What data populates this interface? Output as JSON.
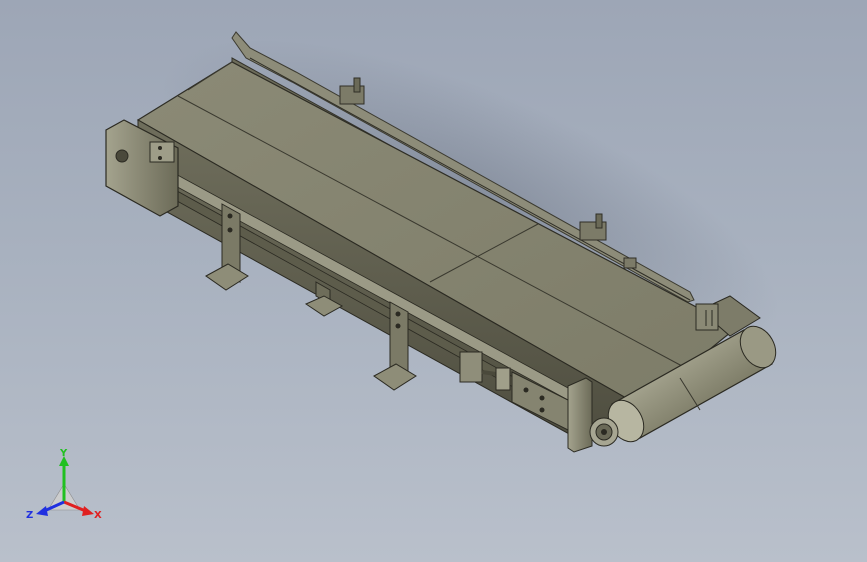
{
  "view": {
    "model": "belt-conveyor",
    "background_top": "#9da6b6",
    "background_bottom": "#b9c0cb",
    "part_color": "#8a8a74"
  },
  "triad": {
    "x_label": "X",
    "y_label": "Y",
    "z_label": "Z",
    "x_color": "#e02020",
    "y_color": "#20c020",
    "z_color": "#2030e0"
  }
}
